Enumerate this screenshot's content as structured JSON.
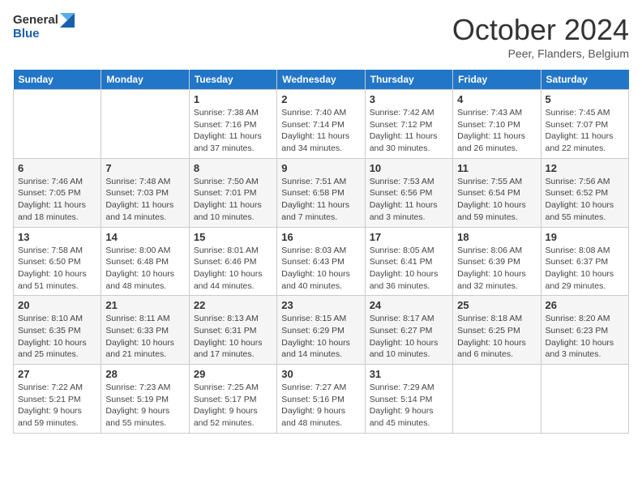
{
  "header": {
    "logo_line1": "General",
    "logo_line2": "Blue",
    "month_title": "October 2024",
    "location": "Peer, Flanders, Belgium"
  },
  "weekdays": [
    "Sunday",
    "Monday",
    "Tuesday",
    "Wednesday",
    "Thursday",
    "Friday",
    "Saturday"
  ],
  "weeks": [
    [
      {
        "day": "",
        "sunrise": "",
        "sunset": "",
        "daylight": ""
      },
      {
        "day": "",
        "sunrise": "",
        "sunset": "",
        "daylight": ""
      },
      {
        "day": "1",
        "sunrise": "Sunrise: 7:38 AM",
        "sunset": "Sunset: 7:16 PM",
        "daylight": "Daylight: 11 hours and 37 minutes."
      },
      {
        "day": "2",
        "sunrise": "Sunrise: 7:40 AM",
        "sunset": "Sunset: 7:14 PM",
        "daylight": "Daylight: 11 hours and 34 minutes."
      },
      {
        "day": "3",
        "sunrise": "Sunrise: 7:42 AM",
        "sunset": "Sunset: 7:12 PM",
        "daylight": "Daylight: 11 hours and 30 minutes."
      },
      {
        "day": "4",
        "sunrise": "Sunrise: 7:43 AM",
        "sunset": "Sunset: 7:10 PM",
        "daylight": "Daylight: 11 hours and 26 minutes."
      },
      {
        "day": "5",
        "sunrise": "Sunrise: 7:45 AM",
        "sunset": "Sunset: 7:07 PM",
        "daylight": "Daylight: 11 hours and 22 minutes."
      }
    ],
    [
      {
        "day": "6",
        "sunrise": "Sunrise: 7:46 AM",
        "sunset": "Sunset: 7:05 PM",
        "daylight": "Daylight: 11 hours and 18 minutes."
      },
      {
        "day": "7",
        "sunrise": "Sunrise: 7:48 AM",
        "sunset": "Sunset: 7:03 PM",
        "daylight": "Daylight: 11 hours and 14 minutes."
      },
      {
        "day": "8",
        "sunrise": "Sunrise: 7:50 AM",
        "sunset": "Sunset: 7:01 PM",
        "daylight": "Daylight: 11 hours and 10 minutes."
      },
      {
        "day": "9",
        "sunrise": "Sunrise: 7:51 AM",
        "sunset": "Sunset: 6:58 PM",
        "daylight": "Daylight: 11 hours and 7 minutes."
      },
      {
        "day": "10",
        "sunrise": "Sunrise: 7:53 AM",
        "sunset": "Sunset: 6:56 PM",
        "daylight": "Daylight: 11 hours and 3 minutes."
      },
      {
        "day": "11",
        "sunrise": "Sunrise: 7:55 AM",
        "sunset": "Sunset: 6:54 PM",
        "daylight": "Daylight: 10 hours and 59 minutes."
      },
      {
        "day": "12",
        "sunrise": "Sunrise: 7:56 AM",
        "sunset": "Sunset: 6:52 PM",
        "daylight": "Daylight: 10 hours and 55 minutes."
      }
    ],
    [
      {
        "day": "13",
        "sunrise": "Sunrise: 7:58 AM",
        "sunset": "Sunset: 6:50 PM",
        "daylight": "Daylight: 10 hours and 51 minutes."
      },
      {
        "day": "14",
        "sunrise": "Sunrise: 8:00 AM",
        "sunset": "Sunset: 6:48 PM",
        "daylight": "Daylight: 10 hours and 48 minutes."
      },
      {
        "day": "15",
        "sunrise": "Sunrise: 8:01 AM",
        "sunset": "Sunset: 6:46 PM",
        "daylight": "Daylight: 10 hours and 44 minutes."
      },
      {
        "day": "16",
        "sunrise": "Sunrise: 8:03 AM",
        "sunset": "Sunset: 6:43 PM",
        "daylight": "Daylight: 10 hours and 40 minutes."
      },
      {
        "day": "17",
        "sunrise": "Sunrise: 8:05 AM",
        "sunset": "Sunset: 6:41 PM",
        "daylight": "Daylight: 10 hours and 36 minutes."
      },
      {
        "day": "18",
        "sunrise": "Sunrise: 8:06 AM",
        "sunset": "Sunset: 6:39 PM",
        "daylight": "Daylight: 10 hours and 32 minutes."
      },
      {
        "day": "19",
        "sunrise": "Sunrise: 8:08 AM",
        "sunset": "Sunset: 6:37 PM",
        "daylight": "Daylight: 10 hours and 29 minutes."
      }
    ],
    [
      {
        "day": "20",
        "sunrise": "Sunrise: 8:10 AM",
        "sunset": "Sunset: 6:35 PM",
        "daylight": "Daylight: 10 hours and 25 minutes."
      },
      {
        "day": "21",
        "sunrise": "Sunrise: 8:11 AM",
        "sunset": "Sunset: 6:33 PM",
        "daylight": "Daylight: 10 hours and 21 minutes."
      },
      {
        "day": "22",
        "sunrise": "Sunrise: 8:13 AM",
        "sunset": "Sunset: 6:31 PM",
        "daylight": "Daylight: 10 hours and 17 minutes."
      },
      {
        "day": "23",
        "sunrise": "Sunrise: 8:15 AM",
        "sunset": "Sunset: 6:29 PM",
        "daylight": "Daylight: 10 hours and 14 minutes."
      },
      {
        "day": "24",
        "sunrise": "Sunrise: 8:17 AM",
        "sunset": "Sunset: 6:27 PM",
        "daylight": "Daylight: 10 hours and 10 minutes."
      },
      {
        "day": "25",
        "sunrise": "Sunrise: 8:18 AM",
        "sunset": "Sunset: 6:25 PM",
        "daylight": "Daylight: 10 hours and 6 minutes."
      },
      {
        "day": "26",
        "sunrise": "Sunrise: 8:20 AM",
        "sunset": "Sunset: 6:23 PM",
        "daylight": "Daylight: 10 hours and 3 minutes."
      }
    ],
    [
      {
        "day": "27",
        "sunrise": "Sunrise: 7:22 AM",
        "sunset": "Sunset: 5:21 PM",
        "daylight": "Daylight: 9 hours and 59 minutes."
      },
      {
        "day": "28",
        "sunrise": "Sunrise: 7:23 AM",
        "sunset": "Sunset: 5:19 PM",
        "daylight": "Daylight: 9 hours and 55 minutes."
      },
      {
        "day": "29",
        "sunrise": "Sunrise: 7:25 AM",
        "sunset": "Sunset: 5:17 PM",
        "daylight": "Daylight: 9 hours and 52 minutes."
      },
      {
        "day": "30",
        "sunrise": "Sunrise: 7:27 AM",
        "sunset": "Sunset: 5:16 PM",
        "daylight": "Daylight: 9 hours and 48 minutes."
      },
      {
        "day": "31",
        "sunrise": "Sunrise: 7:29 AM",
        "sunset": "Sunset: 5:14 PM",
        "daylight": "Daylight: 9 hours and 45 minutes."
      },
      {
        "day": "",
        "sunrise": "",
        "sunset": "",
        "daylight": ""
      },
      {
        "day": "",
        "sunrise": "",
        "sunset": "",
        "daylight": ""
      }
    ]
  ]
}
